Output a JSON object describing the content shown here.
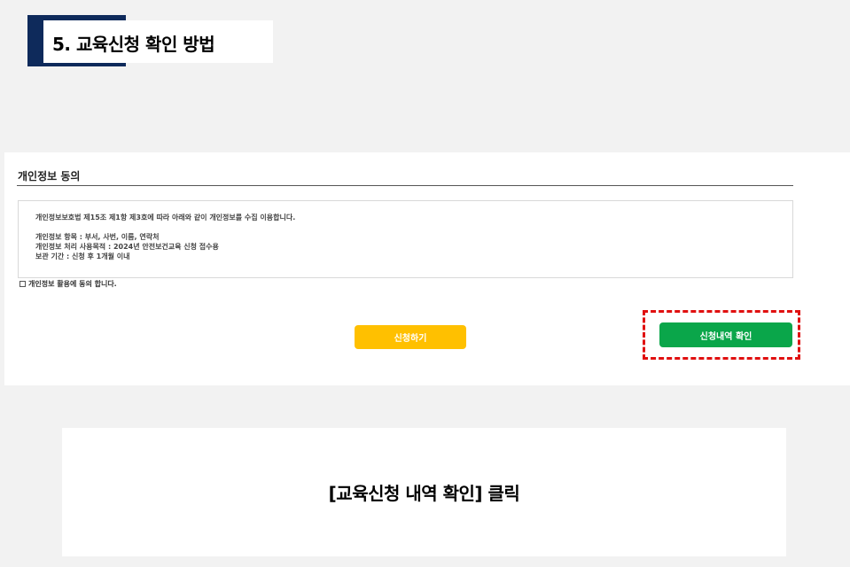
{
  "header": {
    "step_title": "5. 교육신청 확인 방법",
    "accent_color": "#0e2a5b"
  },
  "panel": {
    "title": "개인정보 동의",
    "consent_lines": [
      "개인정보보호법 제15조 제1항 제3호에 따라 아래와 같이 개인정보를 수집 이용합니다.",
      "개인정보 항목 : 부서, 사번, 이름, 연락처",
      "개인정보 처리 사용목적 : 2024년 안전보건교육 신청 접수용",
      "보관 기간 : 신청 후 1개월 이내"
    ],
    "agree_checked": false,
    "agree_label": "개인정보 활용에 동의 합니다.",
    "apply_button_label": "신청하기",
    "apply_button_color": "#ffc000",
    "history_button_label": "신청내역 확인",
    "history_button_color": "#0aa64a",
    "highlight_color": "#e01010"
  },
  "caption": {
    "text": "[교육신청 내역 확인] 클릭"
  }
}
